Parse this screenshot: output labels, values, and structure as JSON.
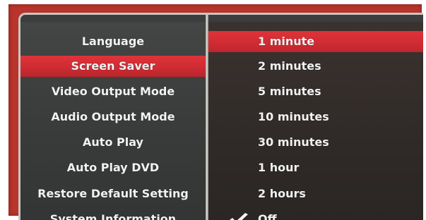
{
  "menu": {
    "items": [
      {
        "label": "Language",
        "selected": false
      },
      {
        "label": "Screen Saver",
        "selected": true
      },
      {
        "label": "Video Output Mode",
        "selected": false
      },
      {
        "label": "Audio Output Mode",
        "selected": false
      },
      {
        "label": "Auto Play",
        "selected": false
      },
      {
        "label": "Auto Play DVD",
        "selected": false
      },
      {
        "label": "Restore Default Setting",
        "selected": false
      },
      {
        "label": "System Information",
        "selected": false
      }
    ]
  },
  "options": {
    "items": [
      {
        "label": "1 minute",
        "highlighted": true,
        "checked": false
      },
      {
        "label": "2 minutes",
        "highlighted": false,
        "checked": false
      },
      {
        "label": "5 minutes",
        "highlighted": false,
        "checked": false
      },
      {
        "label": "10 minutes",
        "highlighted": false,
        "checked": false
      },
      {
        "label": "30 minutes",
        "highlighted": false,
        "checked": false
      },
      {
        "label": "1 hour",
        "highlighted": false,
        "checked": false
      },
      {
        "label": "2 hours",
        "highlighted": false,
        "checked": false
      },
      {
        "label": "Off",
        "highlighted": false,
        "checked": true,
        "icon": "checkmark-icon"
      }
    ]
  },
  "colors": {
    "accent_red": "#d0303a",
    "frame_red": "#b8342c",
    "panel_dark": "#3b3e3c",
    "text": "#f2f2f2"
  }
}
